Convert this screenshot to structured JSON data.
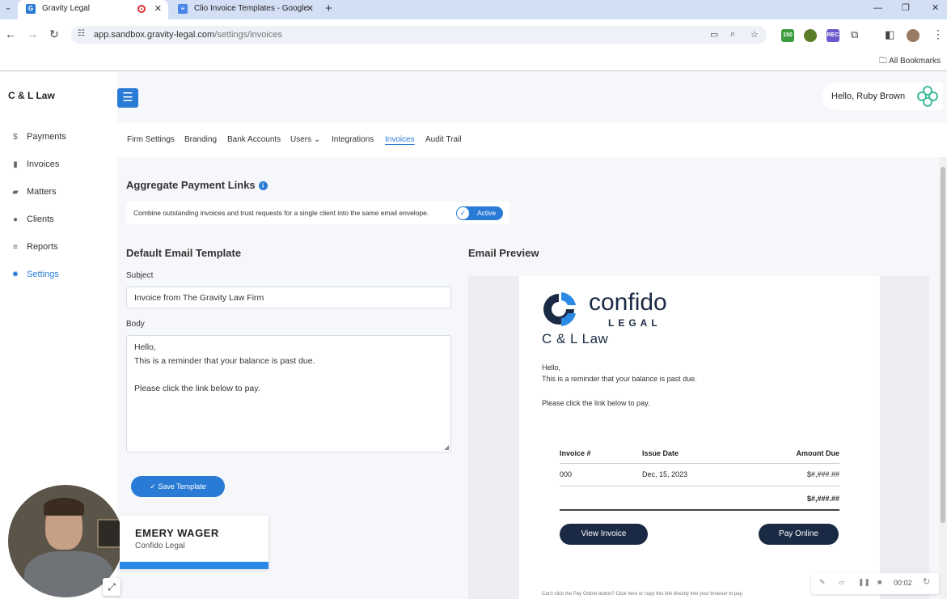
{
  "browser": {
    "tabs": [
      {
        "title": "Gravity Legal",
        "active": true
      },
      {
        "title": "Clio Invoice Templates - Google",
        "active": false
      }
    ],
    "url_host": "app.sandbox.gravity-legal.com",
    "url_path": "/settings/invoices",
    "bookmarks_label": "All Bookmarks",
    "extensions": [
      "150",
      "REC"
    ]
  },
  "sidebar": {
    "firm": "C & L Law",
    "items": [
      {
        "label": "Payments",
        "icon": "dollar-icon"
      },
      {
        "label": "Invoices",
        "icon": "document-icon"
      },
      {
        "label": "Matters",
        "icon": "folder-icon"
      },
      {
        "label": "Clients",
        "icon": "person-icon"
      },
      {
        "label": "Reports",
        "icon": "chart-icon"
      },
      {
        "label": "Settings",
        "icon": "gear-icon",
        "active": true
      }
    ]
  },
  "header": {
    "greeting": "Hello, Ruby Brown"
  },
  "subnav": {
    "items": [
      "Firm Settings",
      "Branding",
      "Bank Accounts",
      "Users",
      "Integrations",
      "Invoices",
      "Audit Trail"
    ],
    "active": "Invoices"
  },
  "aggregate": {
    "title": "Aggregate Payment Links",
    "description": "Combine outstanding invoices and trust requests for a single client into the same email envelope.",
    "toggle_label": "Active"
  },
  "template": {
    "title": "Default Email Template",
    "subject_label": "Subject",
    "subject_value": "Invoice from The Gravity Law Firm",
    "body_label": "Body",
    "body_value": "Hello,\nThis is a reminder that your balance is past due.\n\nPlease click the link below to pay.",
    "save_label": "Save Template"
  },
  "preview": {
    "title": "Email Preview",
    "brand_word": "confido",
    "brand_sub": "LEGAL",
    "firm": "C & L Law",
    "line1": "Hello,",
    "line2": "This is a reminder that your balance is past due.",
    "line3": "Please click the link below to pay.",
    "table": {
      "headers": [
        "Invoice #",
        "Issue Date",
        "Amount Due"
      ],
      "row": [
        "000",
        "Dec, 15, 2023",
        "$#,###.##"
      ],
      "total": "$#,###.##"
    },
    "view_invoice": "View Invoice",
    "pay_online": "Pay Online",
    "footer": "Can't click the Pay Online button? Click here or copy this link directly into your browser to pay."
  },
  "overlay": {
    "presenter_name": "EMERY WAGER",
    "presenter_company": "Confido Legal",
    "recording_time": "00:02"
  },
  "colors": {
    "accent": "#2a7bd5",
    "navy": "#1b2a44",
    "brand_teal": "#3dbb9d"
  }
}
